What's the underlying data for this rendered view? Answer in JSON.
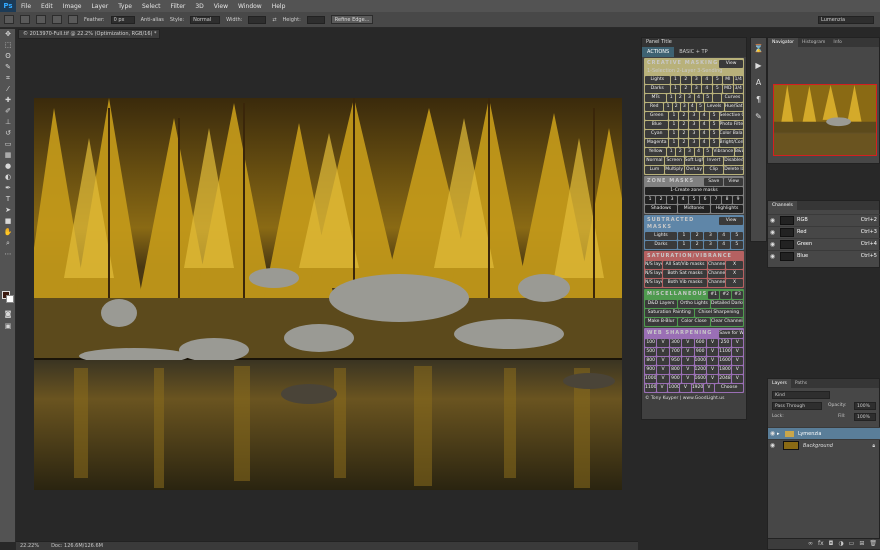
{
  "menubar": {
    "logo": "Ps",
    "items": [
      "File",
      "Edit",
      "Image",
      "Layer",
      "Type",
      "Select",
      "Filter",
      "3D",
      "View",
      "Window",
      "Help"
    ]
  },
  "options": {
    "feather_label": "Feather:",
    "feather_value": "0 px",
    "antialias_label": "Anti-alias",
    "style_label": "Style:",
    "style_value": "Normal",
    "width_label": "Width:",
    "height_label": "Height:",
    "refine_button": "Refine Edge...",
    "workspace_value": "Lumenzia"
  },
  "doc_tab": "© 2013970-Full.tif @ 22.2% (Optimization, RGB/16) *",
  "status": {
    "zoom": "22.22%",
    "doc_label": "Doc: 126.6M/126.6M"
  },
  "actions_panel": {
    "header": "Panel Title",
    "tabs": [
      "ACTIONS",
      "BASIC + TP"
    ],
    "creative": {
      "title": "CREATIVE MASKING",
      "subtitle": "1-Selection  2-Layer  3-Sending",
      "view": "View",
      "rows": [
        {
          "name": "Lights",
          "cells": [
            "1",
            "2",
            "3",
            "4",
            "5",
            "MI",
            "1/4"
          ]
        },
        {
          "name": "Darks",
          "cells": [
            "1",
            "2",
            "3",
            "4",
            "5",
            "MD",
            "3/4"
          ]
        },
        {
          "name": "MTs",
          "cells": [
            "1",
            "2",
            "3",
            "4",
            "5",
            "",
            "Curves"
          ]
        },
        {
          "name": "Red",
          "cells": [
            "1",
            "2",
            "3",
            "4",
            "5",
            "Levels",
            "Hue/Sat"
          ]
        },
        {
          "name": "Green",
          "cells": [
            "1",
            "2",
            "3",
            "4",
            "5",
            "Selective Color"
          ]
        },
        {
          "name": "Blue",
          "cells": [
            "1",
            "2",
            "3",
            "4",
            "5",
            "Photo Filter"
          ]
        },
        {
          "name": "Cyan",
          "cells": [
            "1",
            "2",
            "3",
            "4",
            "5",
            "Color Balance"
          ]
        },
        {
          "name": "Magenta",
          "cells": [
            "1",
            "2",
            "3",
            "4",
            "5",
            "Bright/Contrast"
          ]
        },
        {
          "name": "Yellow",
          "cells": [
            "1",
            "2",
            "3",
            "4",
            "5",
            "Vibrance",
            "B&W"
          ]
        }
      ],
      "modes1": [
        "Normal",
        "Screen",
        "Soft Light",
        "Invert",
        "Disabled"
      ],
      "modes2": [
        "Lum",
        "Multiply",
        "OvrLay",
        "Clip",
        "Delete layer"
      ]
    },
    "zone": {
      "title": "ZONE MASKS",
      "save": "Save",
      "view": "View",
      "create": "1-Create zone masks",
      "cells": [
        "1",
        "2",
        "3",
        "4",
        "5",
        "6",
        "7",
        "8",
        "9"
      ],
      "labels": [
        "Shadows",
        "Midtones",
        "Highlights"
      ]
    },
    "subtracted": {
      "title": "SUBTRACTED MASKS",
      "view": "View",
      "rows": [
        {
          "name": "Lights",
          "cells": [
            "1",
            "2",
            "3",
            "4",
            "5"
          ]
        },
        {
          "name": "Darks",
          "cells": [
            "1",
            "2",
            "3",
            "4",
            "5"
          ]
        }
      ]
    },
    "saturation": {
      "title": "SATURATION/VIBRANCE",
      "rows": [
        [
          "N/S layers",
          "All Sat/Vib masks",
          "Channels",
          "X"
        ],
        [
          "N/S layers",
          "Both Sat masks",
          "Channels",
          "X"
        ],
        [
          "N/S layers",
          "Both Vib masks",
          "Channels",
          "X"
        ]
      ]
    },
    "misc": {
      "title": "MISCELLANEOUS",
      "num": [
        "#1",
        "#2",
        "#3"
      ],
      "rows": [
        [
          "D&D Layers",
          "Ortho Lights",
          "Detailed Darks"
        ],
        [
          "Saturation Painting",
          "Chisel Sharpening"
        ],
        [
          "Make B-Blur",
          "Color Close",
          "Clear Channels"
        ]
      ]
    },
    "web": {
      "title": "WEB SHARPENING",
      "save": "Save for Web",
      "rows": [
        [
          "100",
          "V",
          "300",
          "V",
          "600",
          "V",
          "250",
          "V"
        ],
        [
          "500",
          "V",
          "700",
          "V",
          "900",
          "V",
          "1100",
          "V"
        ],
        [
          "800",
          "V",
          "950",
          "V",
          "1000",
          "V",
          "1600",
          "V"
        ],
        [
          "900",
          "V",
          "800",
          "V",
          "1200",
          "V",
          "1800",
          "V"
        ],
        [
          "1000",
          "V",
          "900",
          "V",
          "1600",
          "V",
          "2048",
          "V"
        ],
        [
          "1100",
          "V",
          "1000",
          "V",
          "1920",
          "V",
          "Choose"
        ]
      ]
    },
    "footer": "© Tony Kuyper | www.GoodLight.us"
  },
  "navigator": {
    "tabs": [
      "Navigator",
      "Histogram",
      "Info"
    ]
  },
  "channels": {
    "tab": "Channels",
    "rows": [
      {
        "name": "RGB",
        "key": "Ctrl+2"
      },
      {
        "name": "Red",
        "key": "Ctrl+3"
      },
      {
        "name": "Green",
        "key": "Ctrl+4"
      },
      {
        "name": "Blue",
        "key": "Ctrl+5"
      }
    ]
  },
  "layers": {
    "tabs": [
      "Layers",
      "Paths"
    ],
    "kind": "Kind",
    "blend": "Pass Through",
    "opacity_label": "Opacity:",
    "opacity": "100%",
    "lock_label": "Lock:",
    "fill_label": "Fill:",
    "fill": "100%",
    "rows": [
      {
        "name": "Lymenzia"
      },
      {
        "name": "Background"
      }
    ]
  },
  "colors": {
    "accent": "#3e6272",
    "creative": "#b8b17a",
    "zone": "#808080",
    "subtracted": "#5f86a8",
    "saturation": "#b56161",
    "misc": "#4f9a4f",
    "web": "#9a6fb5"
  }
}
